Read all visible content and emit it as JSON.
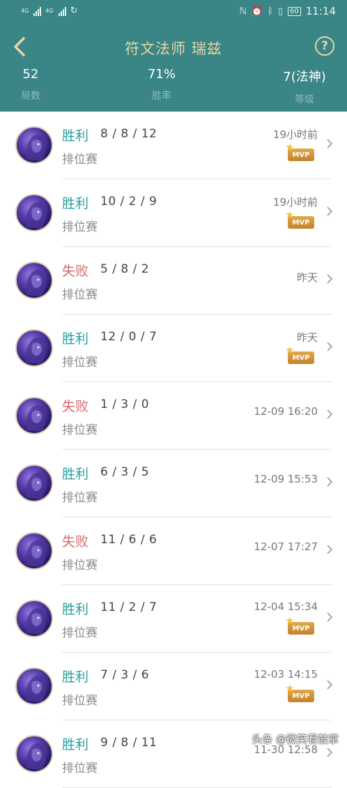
{
  "status_bar": {
    "net1": "4G",
    "net2": "4G",
    "battery": "60",
    "time": "11:14"
  },
  "header": {
    "title": "符文法师 瑞兹",
    "stats": [
      {
        "value": "52",
        "label": "局数"
      },
      {
        "value": "71%",
        "label": "胜率"
      },
      {
        "value": "7(法神)",
        "label": "等级"
      }
    ]
  },
  "matches": [
    {
      "result": "胜利",
      "win": true,
      "kda": "8 / 8 / 12",
      "mode": "排位赛",
      "time": "19小时前",
      "mvp": true
    },
    {
      "result": "胜利",
      "win": true,
      "kda": "10 / 2 / 9",
      "mode": "排位赛",
      "time": "19小时前",
      "mvp": true
    },
    {
      "result": "失败",
      "win": false,
      "kda": "5 / 8 / 2",
      "mode": "排位赛",
      "time": "昨天",
      "mvp": false
    },
    {
      "result": "胜利",
      "win": true,
      "kda": "12 / 0 / 7",
      "mode": "排位赛",
      "time": "昨天",
      "mvp": true
    },
    {
      "result": "失败",
      "win": false,
      "kda": "1 / 3 / 0",
      "mode": "排位赛",
      "time": "12-09 16:20",
      "mvp": false
    },
    {
      "result": "胜利",
      "win": true,
      "kda": "6 / 3 / 5",
      "mode": "排位赛",
      "time": "12-09 15:53",
      "mvp": false
    },
    {
      "result": "失败",
      "win": false,
      "kda": "11 / 6 / 6",
      "mode": "排位赛",
      "time": "12-07 17:27",
      "mvp": false
    },
    {
      "result": "胜利",
      "win": true,
      "kda": "11 / 2 / 7",
      "mode": "排位赛",
      "time": "12-04 15:34",
      "mvp": true
    },
    {
      "result": "胜利",
      "win": true,
      "kda": "7 / 3 / 6",
      "mode": "排位赛",
      "time": "12-03 14:15",
      "mvp": true
    },
    {
      "result": "胜利",
      "win": true,
      "kda": "9 / 8 / 11",
      "mode": "排位赛",
      "time": "11-30 12:58",
      "mvp": false
    }
  ],
  "mvp_label": "MVP",
  "watermark": "头条 @微笑看鼓掌",
  "colors": {
    "header_bg": "#3a8585",
    "title": "#e6d7a6",
    "win": "#2a9f9f",
    "loss": "#d9696e",
    "mvp": "#d6963a"
  },
  "icons": {
    "back": "back-chevron-icon",
    "help": "question-circle-icon",
    "row_arrow": "chevron-right-icon",
    "avatar": "champion-portrait"
  }
}
